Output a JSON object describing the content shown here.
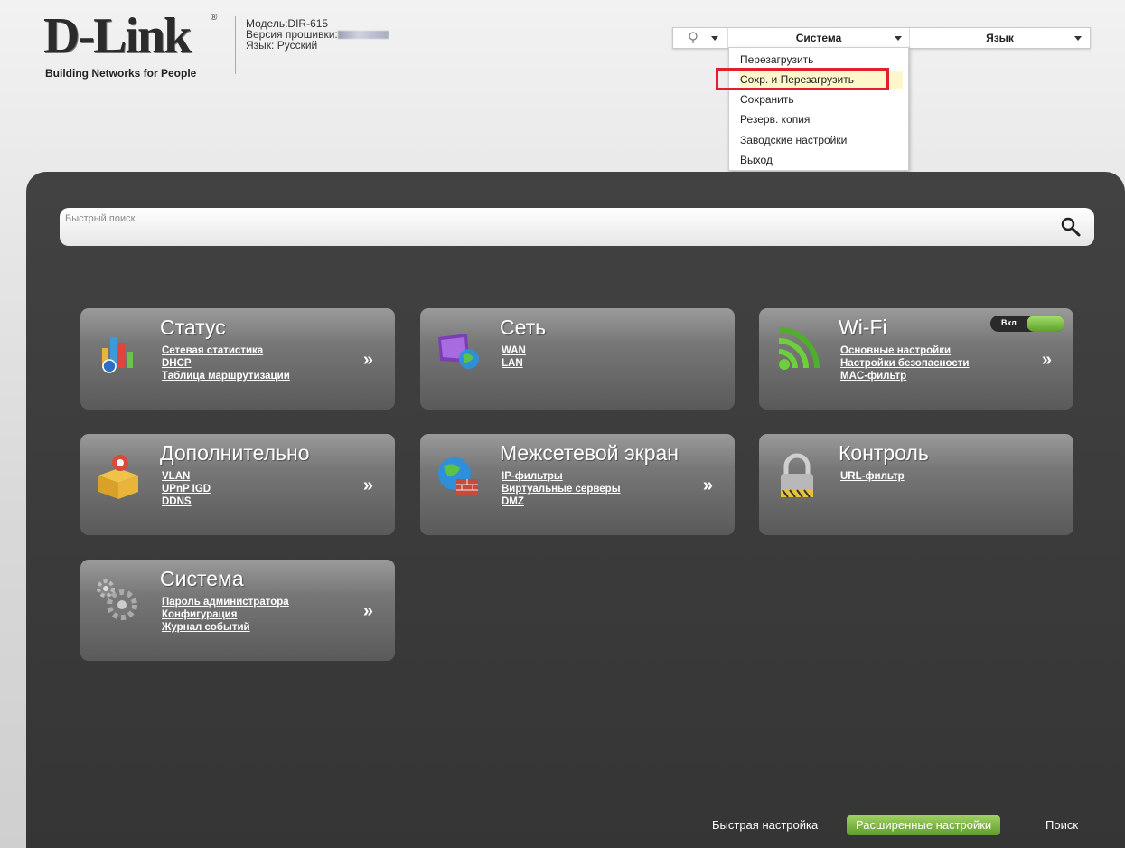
{
  "header": {
    "logo_text": "D-Link",
    "logo_tagline": "Building Networks for People",
    "model": "Модель:DIR-615",
    "firmware_label": "Версия прошивки:",
    "language": "Язык: Русский"
  },
  "topbar": {
    "system_menu": "Система",
    "language_menu": "Язык"
  },
  "system_dropdown": {
    "items": [
      "Перезагрузить",
      "Сохр. и Перезагрузить",
      "Сохранить",
      "Резерв. копия",
      "Заводские настройки",
      "Выход"
    ],
    "highlighted": "Сохр. и Перезагрузить"
  },
  "search": {
    "placeholder": "Быстрый поиск"
  },
  "tiles": [
    {
      "title": "Статус",
      "links": [
        "Сетевая статистика",
        "DHCP",
        "Таблица маршрутизации"
      ]
    },
    {
      "title": "Сеть",
      "links": [
        "WAN",
        "LAN"
      ]
    },
    {
      "title": "Wi-Fi",
      "links": [
        "Основные настройки",
        "Настройки безопасности",
        "MAC-фильтр"
      ],
      "toggle_label": "Вкл"
    },
    {
      "title": "Дополнительно",
      "links": [
        "VLAN",
        "UPnP IGD",
        "DDNS"
      ]
    },
    {
      "title": "Межсетевой экран",
      "links": [
        "IP-фильтры",
        "Виртуальные серверы",
        "DMZ"
      ]
    },
    {
      "title": "Контроль",
      "links": [
        "URL-фильтр"
      ]
    },
    {
      "title": "Система",
      "links": [
        "Пароль администратора",
        "Конфигурация",
        "Журнал событий"
      ]
    }
  ],
  "arrow_glyph": "»",
  "bottom_bar": {
    "quick_setup": "Быстрая настройка",
    "advanced_setup": "Расширенные настройки",
    "search": "Поиск"
  },
  "colors": {
    "highlight_border": "#e0202a",
    "advanced_button": "#6fae36",
    "panel": "#3a3a3a"
  }
}
